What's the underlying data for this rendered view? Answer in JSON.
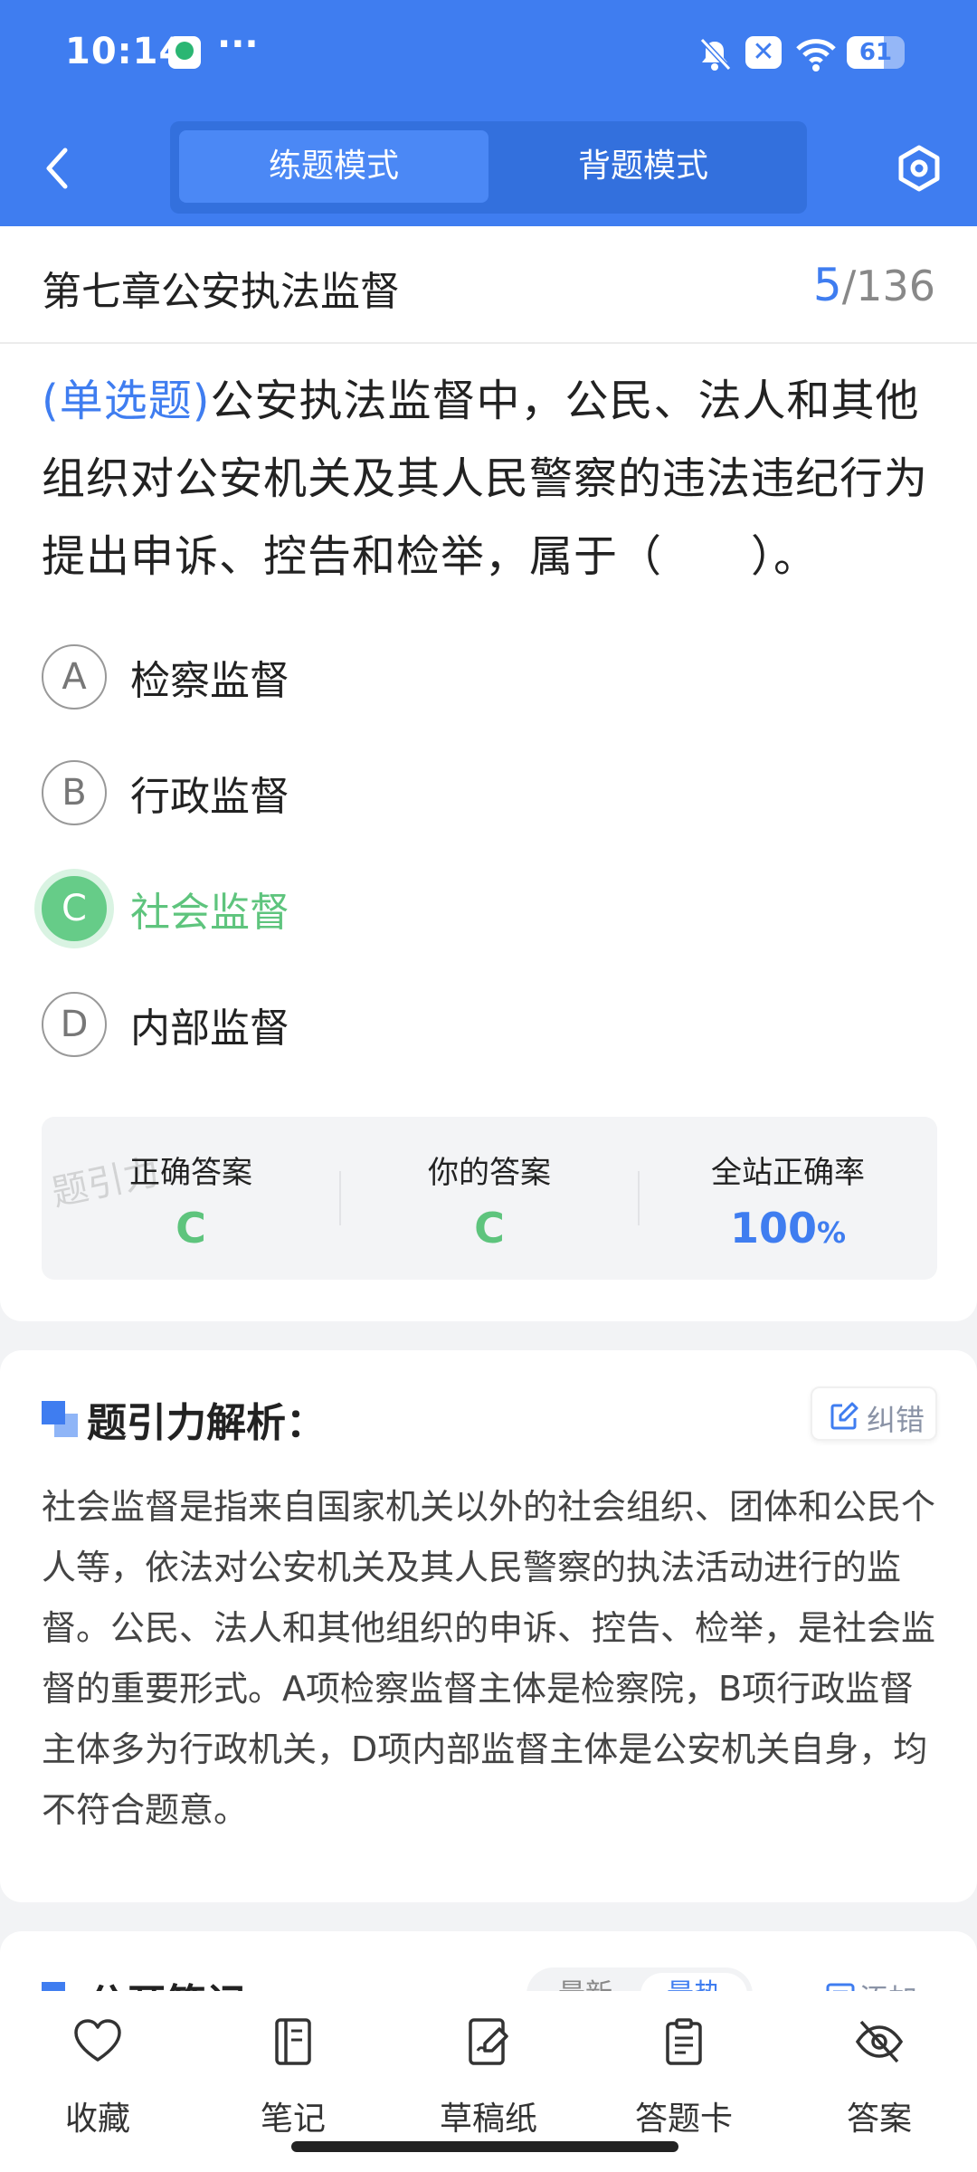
{
  "status_bar": {
    "time": "10:14",
    "dots": "···",
    "battery": "61"
  },
  "header": {
    "tabs": [
      "练题模式",
      "背题模式"
    ]
  },
  "chapter": {
    "title": "第七章公安执法监督",
    "current": "5",
    "total": "/136"
  },
  "question": {
    "type": "(单选题)",
    "text": "公安执法监督中，公民、法人和其他组织对公安机关及其人民警察的违法违纪行为提出申诉、控告和检举，属于（　　）。",
    "options": [
      {
        "letter": "A",
        "text": "检察监督"
      },
      {
        "letter": "B",
        "text": "行政监督"
      },
      {
        "letter": "C",
        "text": "社会监督"
      },
      {
        "letter": "D",
        "text": "内部监督"
      }
    ]
  },
  "stats": {
    "watermark": "题引力",
    "correct_label": "正确答案",
    "correct_value": "C",
    "yours_label": "你的答案",
    "yours_value": "C",
    "rate_label": "全站正确率",
    "rate_value": "100",
    "rate_unit": "%"
  },
  "analysis": {
    "title": "题引力解析：",
    "report_label": "纠错",
    "text": "社会监督是指来自国家机关以外的社会组织、团体和公民个人等，依法对公安机关及其人民警察的执法活动进行的监督。公民、法人和其他组织的申诉、控告、检举，是社会监督的重要形式。A项检察监督主体是检察院，B项行政监督主体多为行政机关，D项内部监督主体是公安机关自身，均不符合题意。"
  },
  "notes": {
    "title": "公开笔记：",
    "sort": [
      "最新",
      "最热"
    ],
    "add_label": "添加"
  },
  "bottom_nav": [
    "收藏",
    "笔记",
    "草稿纸",
    "答题卡",
    "答案"
  ],
  "colors": {
    "primary": "#3f7df0",
    "correct": "#5ec47d"
  }
}
